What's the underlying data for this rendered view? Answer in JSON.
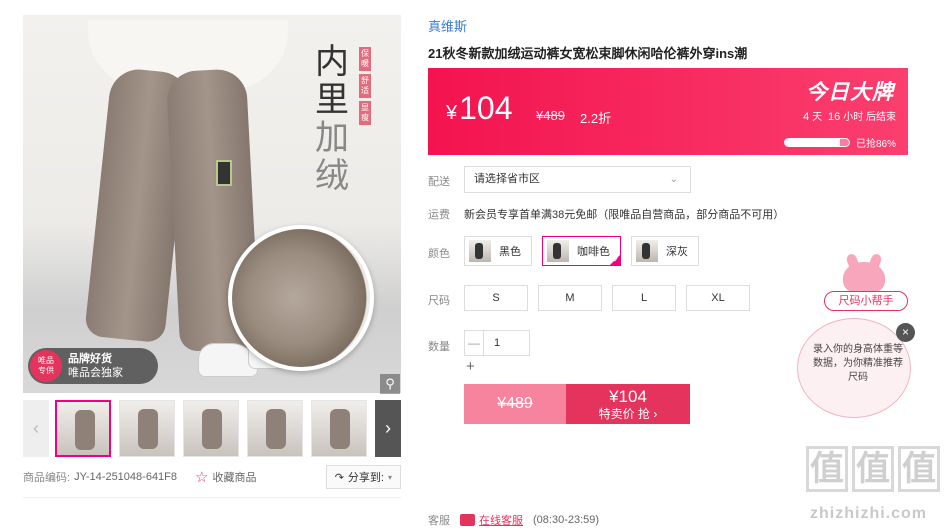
{
  "gallery": {
    "vertical_title_1": "内里",
    "vertical_title_2": "加绒",
    "vertical_tags": [
      "保暖",
      "舒适",
      "显瘦"
    ],
    "badge_round_line1": "唯品",
    "badge_round_line2": "专供",
    "badge_line1": "品牌好货",
    "badge_line2": "唯品会独家",
    "thumb_prev": "‹",
    "thumb_next": "›",
    "thumb_count": 6,
    "product_code_label": "商品编码:",
    "product_code": "JY-14-251048-641F8",
    "favorite_label": "收藏商品",
    "share_label": "分享到:"
  },
  "product": {
    "brand": "真维斯",
    "title": "21秋冬新款加绒运动裤女宽松束脚休闲哈伦裤外穿ins潮"
  },
  "price_box": {
    "currency": "¥",
    "price": "104",
    "original_price": "¥489",
    "discount": "2.2折",
    "banner": "今日大牌",
    "days": "4",
    "days_unit": "天",
    "hours": "16",
    "hours_unit": "小时",
    "ends": "后结束",
    "sold_percent": 0.86,
    "sold_label": "已抢86%"
  },
  "options": {
    "delivery_label": "配送",
    "delivery_placeholder": "请选择省市区",
    "shipping_label": "运费",
    "shipping_text": "新会员专享首单满38元免邮（限唯品自营商品，部分商品不可用）",
    "color_label": "颜色",
    "colors": [
      "黑色",
      "咖啡色",
      "深灰"
    ],
    "size_label": "尺码",
    "sizes": [
      "S",
      "M",
      "L",
      "XL"
    ],
    "qty_label": "数量",
    "qty_minus": "—",
    "qty_value": "1",
    "qty_plus": "+"
  },
  "buy": {
    "orig_price": "¥489",
    "sale_price": "¥104",
    "sale_label": "特卖价 抢 ›"
  },
  "service": {
    "label": "客服",
    "link": "在线客服",
    "hours": "(08:30-23:59)"
  },
  "size_helper": {
    "tag": "尺码小帮手",
    "text": "录入你的身高体重等数据，为你精准推荐尺码",
    "close": "×"
  },
  "watermark": {
    "chars": [
      "值",
      "值",
      "值"
    ],
    "url": "zhizhizhi.com"
  },
  "colors": {
    "accent": "#e4335c",
    "brand_link": "#3a7bd5",
    "selected_border": "#f10180"
  }
}
